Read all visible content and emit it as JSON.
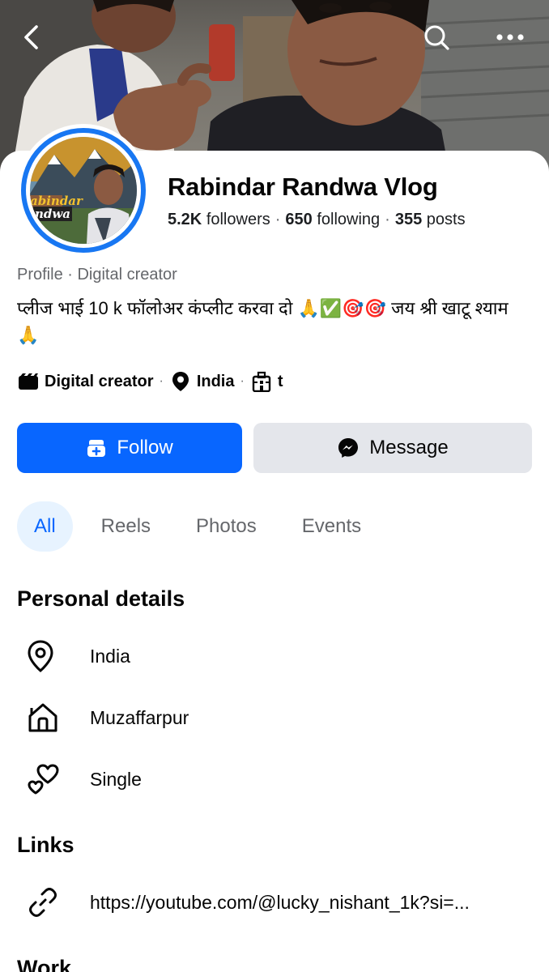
{
  "header": {
    "back_icon": "chevron-left-icon",
    "search_icon": "search-icon",
    "more_icon": "more-horizontal-icon"
  },
  "profile": {
    "name": "Rabindar Randwa Vlog",
    "followers_count": "5.2K",
    "followers_label": "followers",
    "following_count": "650",
    "following_label": "following",
    "posts_count": "355",
    "posts_label": "posts",
    "category_line": "Profile · Digital creator",
    "bio": "प्लीज भाई 10 k फॉलोअर कंप्लीट करवा दो 🙏✅🎯🎯 जय श्री खाटू श्याम🙏",
    "avatar_text_1": "abindar",
    "avatar_text_2": "ndwa"
  },
  "meta": {
    "category": "Digital creator",
    "location": "India",
    "work": "t"
  },
  "actions": {
    "follow_label": "Follow",
    "message_label": "Message"
  },
  "tabs": [
    {
      "label": "All",
      "active": true
    },
    {
      "label": "Reels",
      "active": false
    },
    {
      "label": "Photos",
      "active": false
    },
    {
      "label": "Events",
      "active": false
    }
  ],
  "personal_details": {
    "title": "Personal details",
    "items": [
      {
        "icon": "location-pin-icon",
        "text": "India"
      },
      {
        "icon": "home-icon",
        "text": "Muzaffarpur"
      },
      {
        "icon": "hearts-icon",
        "text": "Single"
      }
    ]
  },
  "links": {
    "title": "Links",
    "items": [
      {
        "icon": "link-icon",
        "text": "https://youtube.com/@lucky_nishant_1k?si=..."
      }
    ]
  },
  "work": {
    "title": "Work"
  },
  "colors": {
    "brand_blue": "#0866ff",
    "avatar_ring": "#1877f2",
    "secondary_button": "#e4e6eb",
    "active_tab_bg": "#e7f3ff",
    "muted_text": "#65676b"
  }
}
